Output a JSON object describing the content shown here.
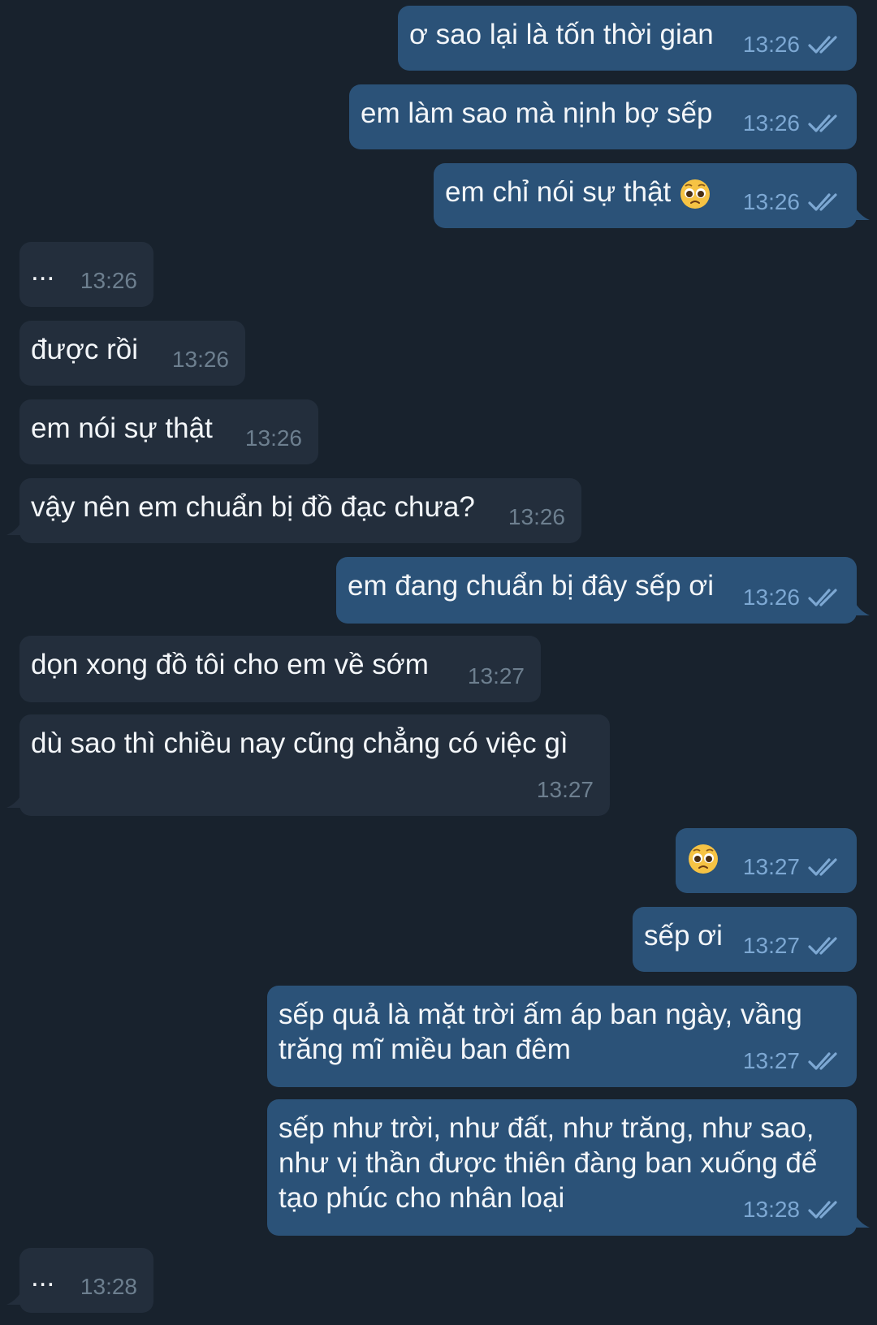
{
  "colors": {
    "background": "#18222d",
    "outgoing_bubble": "#2b5278",
    "incoming_bubble": "#232e3c",
    "outgoing_time": "#7da8d3",
    "incoming_time": "#6d7f8f",
    "text": "#f3f6f9"
  },
  "messages": [
    {
      "dir": "out",
      "text": "ơ sao lại là tốn thời gian",
      "time": "13:26",
      "ticks": "double-check-icon"
    },
    {
      "dir": "out",
      "text": "em làm sao mà nịnh bợ sếp",
      "time": "13:26",
      "ticks": "double-check-icon"
    },
    {
      "dir": "out",
      "text": "em chỉ nói sự thật",
      "emoji": "pleading-face-icon",
      "time": "13:26",
      "ticks": "double-check-icon"
    },
    {
      "dir": "in",
      "text": "...",
      "time": "13:26"
    },
    {
      "dir": "in",
      "text": "được rồi",
      "time": "13:26"
    },
    {
      "dir": "in",
      "text": "em nói sự thật",
      "time": "13:26"
    },
    {
      "dir": "in",
      "text": "vậy nên em chuẩn bị đồ đạc chưa?",
      "time": "13:26"
    },
    {
      "dir": "out",
      "text": "em đang chuẩn bị đây sếp ơi",
      "time": "13:26",
      "ticks": "double-check-icon"
    },
    {
      "dir": "in",
      "text": "dọn xong đồ tôi cho em về sớm",
      "time": "13:27"
    },
    {
      "dir": "in",
      "text": "dù sao thì chiều nay cũng chẳng có việc gì",
      "time": "13:27"
    },
    {
      "dir": "out",
      "text": "",
      "emoji": "pleading-face-icon",
      "time": "13:27",
      "ticks": "double-check-icon"
    },
    {
      "dir": "out",
      "text": "sếp ơi",
      "time": "13:27",
      "ticks": "double-check-icon"
    },
    {
      "dir": "out",
      "text": "sếp quả là mặt trời ấm áp ban ngày, vầng trăng mĩ miều ban đêm",
      "time": "13:27",
      "ticks": "double-check-icon"
    },
    {
      "dir": "out",
      "text": "sếp như trời, như đất, như trăng, như sao, như vị thần được thiên đàng ban xuống để tạo phúc cho nhân loại",
      "time": "13:28",
      "ticks": "double-check-icon"
    },
    {
      "dir": "in",
      "text": "...",
      "time": "13:28"
    }
  ]
}
